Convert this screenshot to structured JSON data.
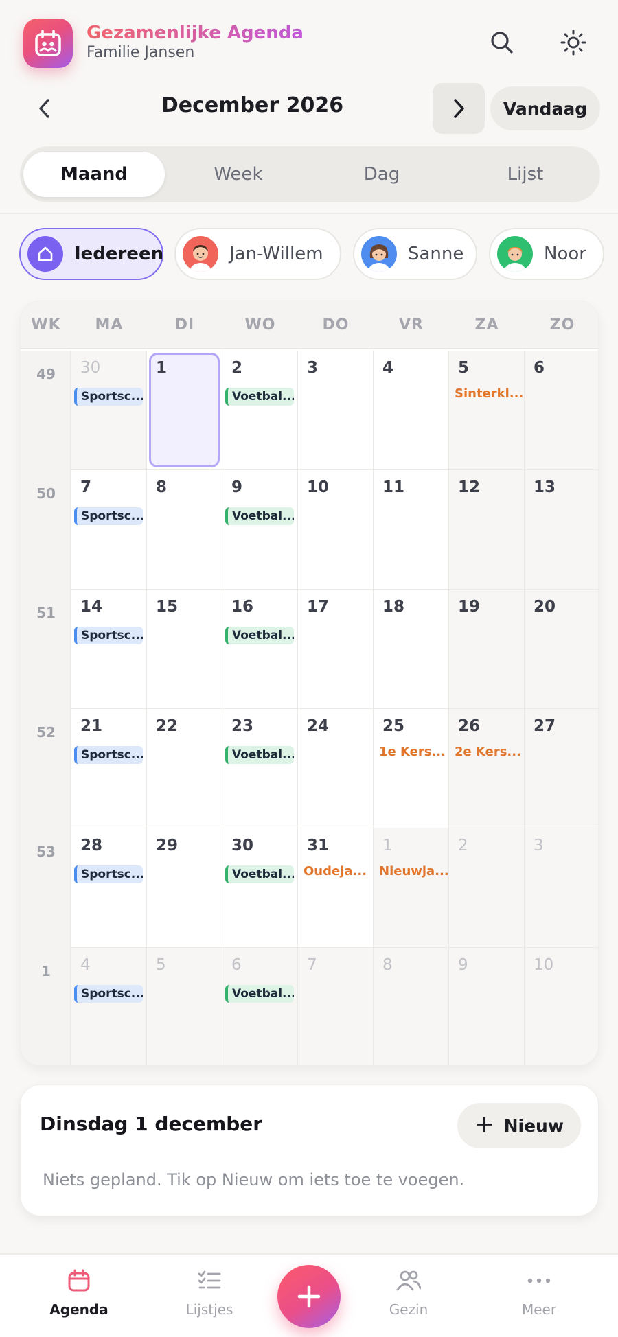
{
  "header": {
    "title": "Gezamenlijke Agenda",
    "subtitle": "Familie Jansen",
    "logo_icon": "calendar-family-icon",
    "search_icon": "search-icon",
    "theme_icon": "sun-icon",
    "accent": "#e9507e"
  },
  "month_nav": {
    "title": "December 2026",
    "today_label": "Vandaag"
  },
  "view_tabs": [
    {
      "label": "Maand",
      "active": true
    },
    {
      "label": "Week",
      "active": false
    },
    {
      "label": "Dag",
      "active": false
    },
    {
      "label": "Lijst",
      "active": false
    }
  ],
  "filters": [
    {
      "label": "Iedereen",
      "active": true,
      "color": "#7b61f0"
    },
    {
      "label": "Jan-Willem",
      "active": false,
      "color": "#f0645a"
    },
    {
      "label": "Sanne",
      "active": false,
      "color": "#4f8ef0"
    },
    {
      "label": "Noor",
      "active": false,
      "color": "#2fbf71"
    }
  ],
  "calendar": {
    "week_header": "WK",
    "day_headers": [
      "MA",
      "DI",
      "WO",
      "DO",
      "VR",
      "ZA",
      "ZO"
    ],
    "weeks": [
      {
        "wk": "49",
        "days": [
          {
            "n": "30",
            "muted": true,
            "event": "Sportsc...",
            "type": "sport"
          },
          {
            "n": "1",
            "selected": true
          },
          {
            "n": "2",
            "event": "Voetbal...",
            "type": "soccer"
          },
          {
            "n": "3"
          },
          {
            "n": "4"
          },
          {
            "n": "5",
            "holiday": "Sinterkl..."
          },
          {
            "n": "6"
          }
        ]
      },
      {
        "wk": "50",
        "days": [
          {
            "n": "7",
            "event": "Sportsc...",
            "type": "sport"
          },
          {
            "n": "8"
          },
          {
            "n": "9",
            "event": "Voetbal...",
            "type": "soccer"
          },
          {
            "n": "10"
          },
          {
            "n": "11"
          },
          {
            "n": "12"
          },
          {
            "n": "13"
          }
        ]
      },
      {
        "wk": "51",
        "days": [
          {
            "n": "14",
            "event": "Sportsc...",
            "type": "sport"
          },
          {
            "n": "15"
          },
          {
            "n": "16",
            "event": "Voetbal...",
            "type": "soccer"
          },
          {
            "n": "17"
          },
          {
            "n": "18"
          },
          {
            "n": "19"
          },
          {
            "n": "20"
          }
        ]
      },
      {
        "wk": "52",
        "days": [
          {
            "n": "21",
            "event": "Sportsc...",
            "type": "sport"
          },
          {
            "n": "22"
          },
          {
            "n": "23",
            "event": "Voetbal...",
            "type": "soccer"
          },
          {
            "n": "24"
          },
          {
            "n": "25",
            "holiday": "1e Kers..."
          },
          {
            "n": "26",
            "holiday": "2e Kers..."
          },
          {
            "n": "27"
          }
        ]
      },
      {
        "wk": "53",
        "days": [
          {
            "n": "28",
            "event": "Sportsc...",
            "type": "sport"
          },
          {
            "n": "29"
          },
          {
            "n": "30",
            "event": "Voetbal...",
            "type": "soccer"
          },
          {
            "n": "31",
            "holiday": "Oudeja..."
          },
          {
            "n": "1",
            "muted": true,
            "holiday": "Nieuwja..."
          },
          {
            "n": "2",
            "muted": true
          },
          {
            "n": "3",
            "muted": true
          }
        ]
      },
      {
        "wk": "1",
        "days": [
          {
            "n": "4",
            "muted": true,
            "event": "Sportsc...",
            "type": "sport"
          },
          {
            "n": "5",
            "muted": true
          },
          {
            "n": "6",
            "muted": true,
            "event": "Voetbal...",
            "type": "soccer"
          },
          {
            "n": "7",
            "muted": true
          },
          {
            "n": "8",
            "muted": true
          },
          {
            "n": "9",
            "muted": true
          },
          {
            "n": "10",
            "muted": true
          }
        ]
      }
    ]
  },
  "day_panel": {
    "title": "Dinsdag 1 december",
    "new_label": "Nieuw",
    "empty_text": "Niets gepland. Tik op Nieuw om iets toe te voegen."
  },
  "bottom_nav": [
    {
      "label": "Agenda",
      "icon": "calendar-icon",
      "active": true
    },
    {
      "label": "Lijstjes",
      "icon": "checklist-icon",
      "active": false
    },
    {
      "label": "Gezin",
      "icon": "people-icon",
      "active": false
    },
    {
      "label": "Meer",
      "icon": "more-dots-icon",
      "active": false
    }
  ]
}
